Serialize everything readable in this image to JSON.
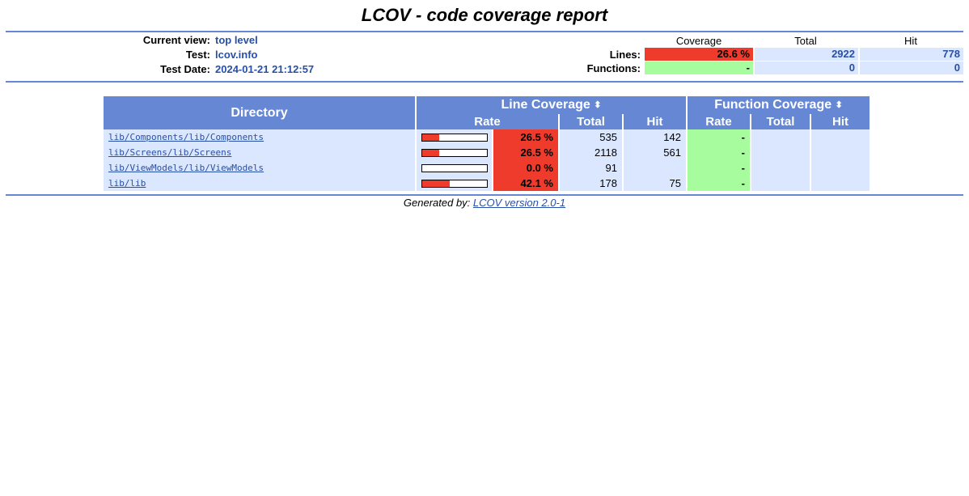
{
  "title": "LCOV - code coverage report",
  "header": {
    "current_view_label": "Current view:",
    "current_view_value": "top level",
    "test_label": "Test:",
    "test_value": "lcov.info",
    "test_date_label": "Test Date:",
    "test_date_value": "2024-01-21 21:12:57",
    "columns": [
      "Coverage",
      "Total",
      "Hit"
    ],
    "lines": {
      "label": "Lines:",
      "coverage": "26.6 %",
      "total": "2922",
      "hit": "778"
    },
    "functions": {
      "label": "Functions:",
      "coverage": "-",
      "total": "0",
      "hit": "0"
    }
  },
  "table": {
    "directory_header": "Directory",
    "line_coverage_header": "Line Coverage",
    "function_coverage_header": "Function Coverage",
    "sub_headers": [
      "Rate",
      "Total",
      "Hit",
      "Rate",
      "Total",
      "Hit"
    ],
    "rows": [
      {
        "name": "lib/Components/lib/Components",
        "rate": "26.5 %",
        "rate_value": 26.5,
        "total": "535",
        "hit": "142",
        "frate": "-",
        "ftotal": "",
        "fhit": ""
      },
      {
        "name": "lib/Screens/lib/Screens",
        "rate": "26.5 %",
        "rate_value": 26.5,
        "total": "2118",
        "hit": "561",
        "frate": "-",
        "ftotal": "",
        "fhit": ""
      },
      {
        "name": "lib/ViewModels/lib/ViewModels",
        "rate": "0.0 %",
        "rate_value": 0.0,
        "total": "91",
        "hit": "",
        "frate": "-",
        "ftotal": "",
        "fhit": ""
      },
      {
        "name": "lib/lib",
        "rate": "42.1 %",
        "rate_value": 42.1,
        "total": "178",
        "hit": "75",
        "frate": "-",
        "ftotal": "",
        "fhit": ""
      }
    ]
  },
  "footer": {
    "prefix": "Generated by:",
    "link_text": "LCOV version 2.0-1"
  },
  "colors": {
    "header_blue": "#6688d4",
    "row_bg": "#dae7fe",
    "low_red": "#ee3b2c",
    "hi_green": "#a7fc9d",
    "link_blue": "#284fa8"
  }
}
